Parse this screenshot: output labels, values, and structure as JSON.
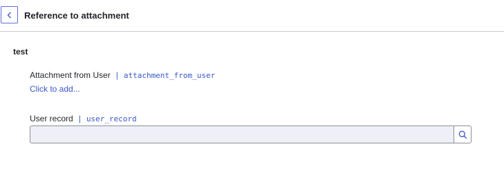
{
  "header": {
    "back_icon": "chevron-left-icon",
    "title": "Reference to attachment"
  },
  "section": {
    "title": "test"
  },
  "fields": {
    "attachment": {
      "label": "Attachment from User",
      "separator": "|",
      "variable": "attachment_from_user",
      "action_link": "Click to add..."
    },
    "user_record": {
      "label": "User record",
      "separator": "|",
      "variable": "user_record",
      "value": "",
      "search_icon": "search-icon"
    }
  },
  "colors": {
    "accent": "#3a56c9",
    "border": "#8a8e95",
    "input_bg": "#eeeff7"
  }
}
